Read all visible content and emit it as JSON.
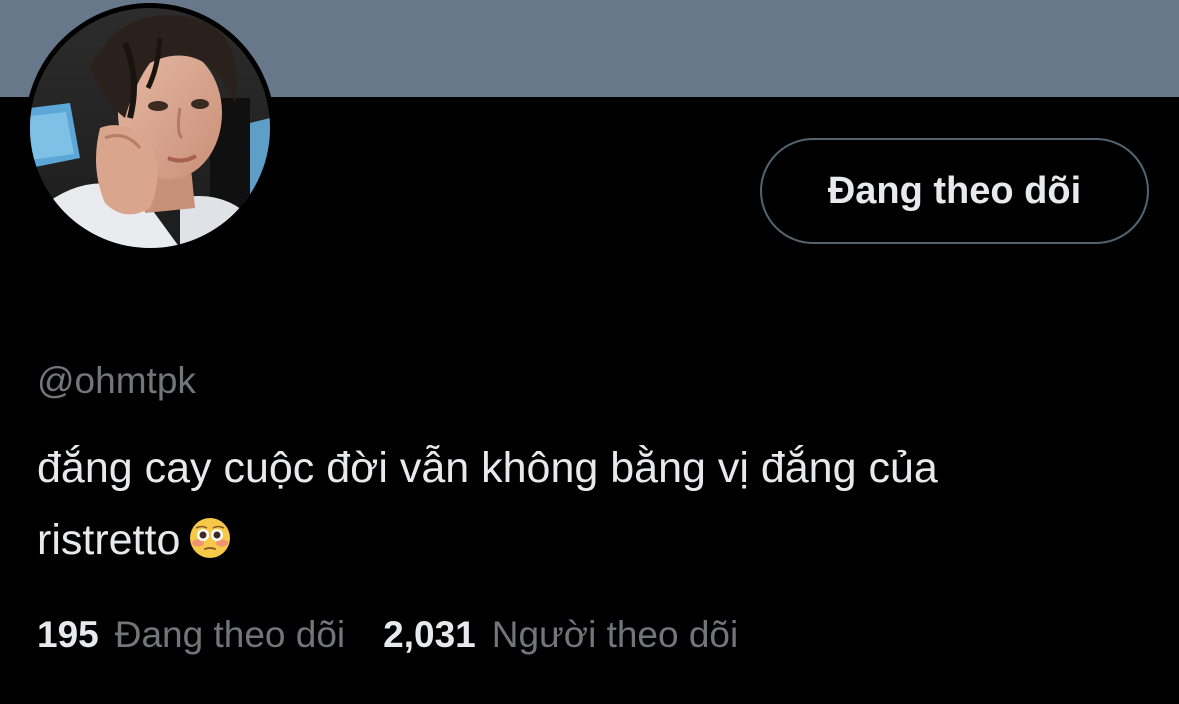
{
  "profile": {
    "banner_color": "#66788a",
    "avatar_icon": "profile-photo",
    "follow_button_label": "Đang theo dõi",
    "handle": "@ohmtpk",
    "bio_line1": "đắng cay cuộc đời vẫn không bằng vị đắng của",
    "bio_line2": "ristretto",
    "bio_emoji": "flushed-face-emoji"
  },
  "stats": {
    "following_count": "195",
    "following_label": "Đang theo dõi",
    "followers_count": "2,031",
    "followers_label": "Người theo dõi"
  },
  "colors": {
    "background": "#000000",
    "text_primary": "#e7e9ea",
    "text_secondary": "#71767b",
    "button_border": "#536471"
  }
}
